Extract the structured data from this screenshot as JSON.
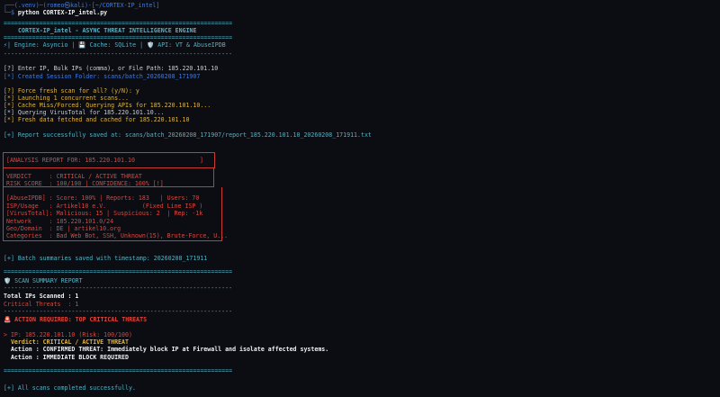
{
  "prompt": {
    "line1": "┌──(.venv)─(romeo㉿kali)-[~/CORTEX-IP_intel]",
    "line2_prefix": "└─$ ",
    "command": "python CORTEX-IP_intel.py"
  },
  "banner": {
    "rule": "================================================================",
    "title": "CORTEX-IP_intel - ASYNC THREAT INTELLIGENCE ENGINE",
    "meta": "⚡| Engine: Asyncio | 💾 Cache: SQLite | 🛡️ API: VT & AbuseIPDB",
    "rule2": "----------------------------------------------------------------"
  },
  "session": {
    "input_line": "[?] Enter IP, Bulk IPs (comma), or File Path: 185.220.101.10",
    "folder_line": "[*] Created Session Folder: scans/batch_20260208_171907",
    "force_line": "[?] Force fresh scan for all? (y/N): y",
    "launch_line": "[*] Launching 1 concurrent scans...",
    "cache_line": "[*] Cache Miss/Forced: Querying APIs for 185.220.101.10...",
    "vt_line": "[*] Querying VirusTotal for 185.220.101.10...",
    "fresh_line": "[*] Fresh data fetched and cached for 185.220.101.10",
    "saved_line": "[+] Report successfully saved at: scans/batch_20260208_171907/report_185.220.101.10_20260208_171911.txt"
  },
  "analysis": {
    "header": "[ANALYSIS REPORT FOR: 185.220.101.10",
    "header_end": "]",
    "verdict": "VERDICT     : CRITICAL / ACTIVE THREAT",
    "risk": "RISK SCORE  : 100/100 | CONFIDENCE: 100% [!]",
    "abuse": "[AbuseIPDB] : Score: 100% | Reports: 183   | Users: 70",
    "isp": "ISP/Usage   : Artikel10 e.V.          (Fixed Line ISP )",
    "vt": "[VirusTotal]: Malicious: 15 | Suspicious: 2  | Rep: -1k",
    "network": "Network     : 185.220.101.0/24",
    "geo": "Geo/Domain  : DE | artikel10.org",
    "categories": "Categories  : Bad Web Bot, SSH, Unknown(15), Brute-Force, U..."
  },
  "batch_line": "[+] Batch summaries saved with timestamp: 20260208_171911",
  "summary": {
    "rule": "================================================================",
    "title": "🛡️ SCAN SUMMARY REPORT",
    "rule2": "----------------------------------------------------------------",
    "total": "Total IPs Scanned : 1",
    "critical": "Critical Threats  : 1",
    "rule3": "----------------------------------------------------------------",
    "action_title": "🚨 ACTION REQUIRED: TOP CRITICAL THREATS",
    "ip_line": "> IP: 185.220.101.10 (Risk: 100/100)",
    "verdict_line": "  Verdict: CRITICAL / ACTIVE THREAT",
    "action1": "  Action : CONFIRMED THREAT: Immediately block IP at Firewall and isolate affected systems.",
    "action2": "  Action : IMMEDIATE BLOCK REQUIRED",
    "rule4": "================================================================"
  },
  "done_line": "[+] All scans completed successfully."
}
